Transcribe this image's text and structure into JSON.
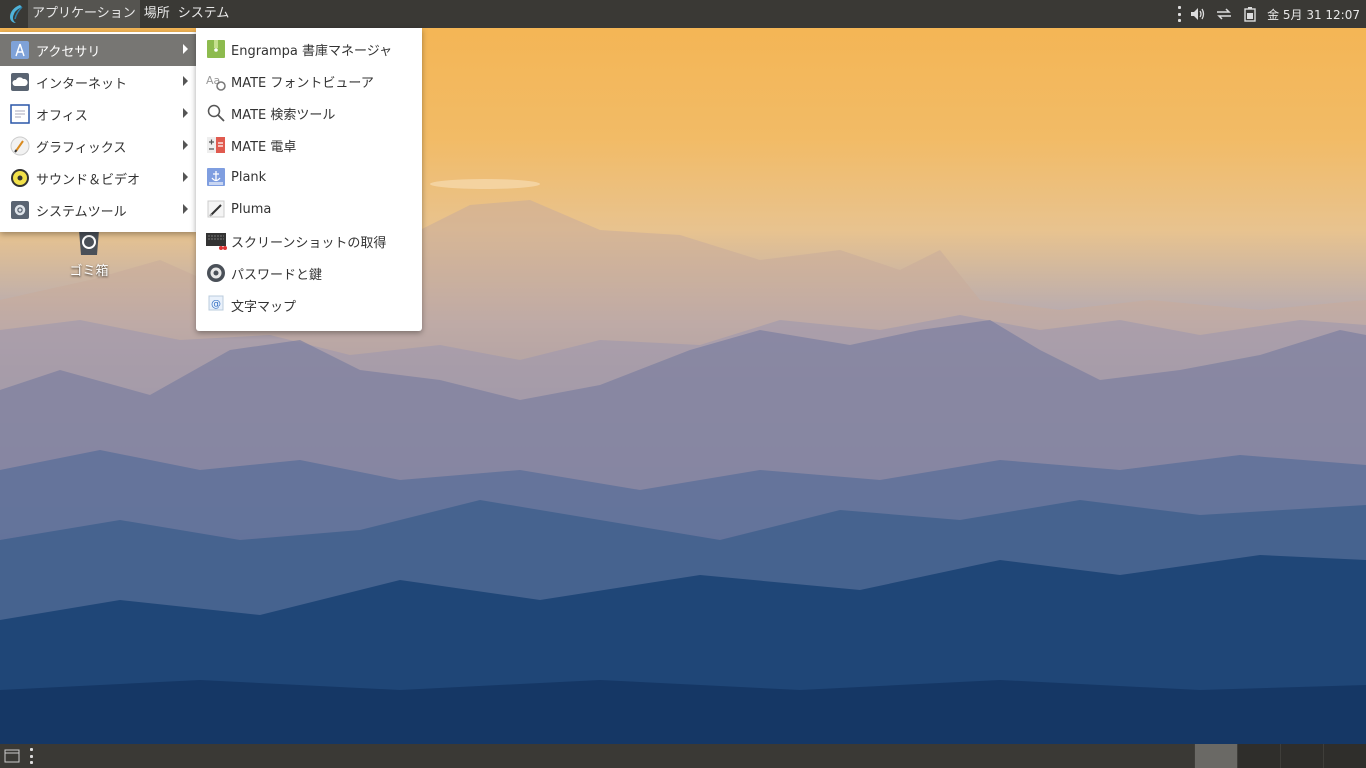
{
  "top_panel": {
    "menus": [
      {
        "label": "アプリケーション",
        "active": true
      },
      {
        "label": "場所",
        "active": false
      },
      {
        "label": "システム",
        "active": false
      }
    ],
    "clock": "金 5月 31 12:07",
    "tray_icons": [
      "volume-icon",
      "network-icon",
      "battery-icon"
    ]
  },
  "main_menu": {
    "items": [
      {
        "label": "アクセサリ",
        "icon": "accessories-icon",
        "active": true
      },
      {
        "label": "インターネット",
        "icon": "internet-icon",
        "active": false
      },
      {
        "label": "オフィス",
        "icon": "office-icon",
        "active": false
      },
      {
        "label": "グラフィックス",
        "icon": "graphics-icon",
        "active": false
      },
      {
        "label": "サウンド＆ビデオ",
        "icon": "sound-video-icon",
        "active": false
      },
      {
        "label": "システムツール",
        "icon": "system-tools-icon",
        "active": false
      }
    ]
  },
  "sub_menu": {
    "items": [
      {
        "label": "Engrampa 書庫マネージャ",
        "icon": "archive-manager-icon"
      },
      {
        "label": "MATE フォントビューア",
        "icon": "font-viewer-icon"
      },
      {
        "label": "MATE 検索ツール",
        "icon": "search-icon"
      },
      {
        "label": "MATE 電卓",
        "icon": "calculator-icon"
      },
      {
        "label": "Plank",
        "icon": "plank-icon"
      },
      {
        "label": "Pluma",
        "icon": "text-editor-icon"
      },
      {
        "label": "スクリーンショットの取得",
        "icon": "screenshot-icon"
      },
      {
        "label": "パスワードと鍵",
        "icon": "passwords-keys-icon"
      },
      {
        "label": "文字マップ",
        "icon": "character-map-icon"
      }
    ]
  },
  "desktop": {
    "trash_label": "ゴミ箱"
  }
}
